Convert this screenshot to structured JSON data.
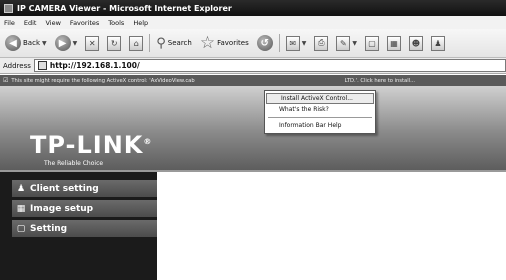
{
  "window": {
    "title": "IP CAMERA Viewer - Microsoft Internet Explorer"
  },
  "menubar": {
    "items": [
      "File",
      "Edit",
      "View",
      "Favorites",
      "Tools",
      "Help"
    ]
  },
  "toolbar": {
    "back_label": "Back",
    "search_label": "Search",
    "favorites_label": "Favorites"
  },
  "addressbar": {
    "label": "Address",
    "url": "http://192.168.1.100/"
  },
  "infobar": {
    "message_start": "This site might require the following ActiveX control: 'AxVideoView.cab",
    "message_end": "LTD.'. Click here to install..."
  },
  "context_menu": {
    "items": [
      "Install ActiveX Control...",
      "What's the Risk?",
      "Information Bar Help"
    ]
  },
  "brand": {
    "logo": "TP-LINK",
    "tagline": "The Reliable Choice"
  },
  "sidebar": {
    "items": [
      {
        "label": "Client setting",
        "icon": "users-icon"
      },
      {
        "label": "Image setup",
        "icon": "image-icon"
      },
      {
        "label": "Setting",
        "icon": "settings-icon"
      }
    ]
  }
}
